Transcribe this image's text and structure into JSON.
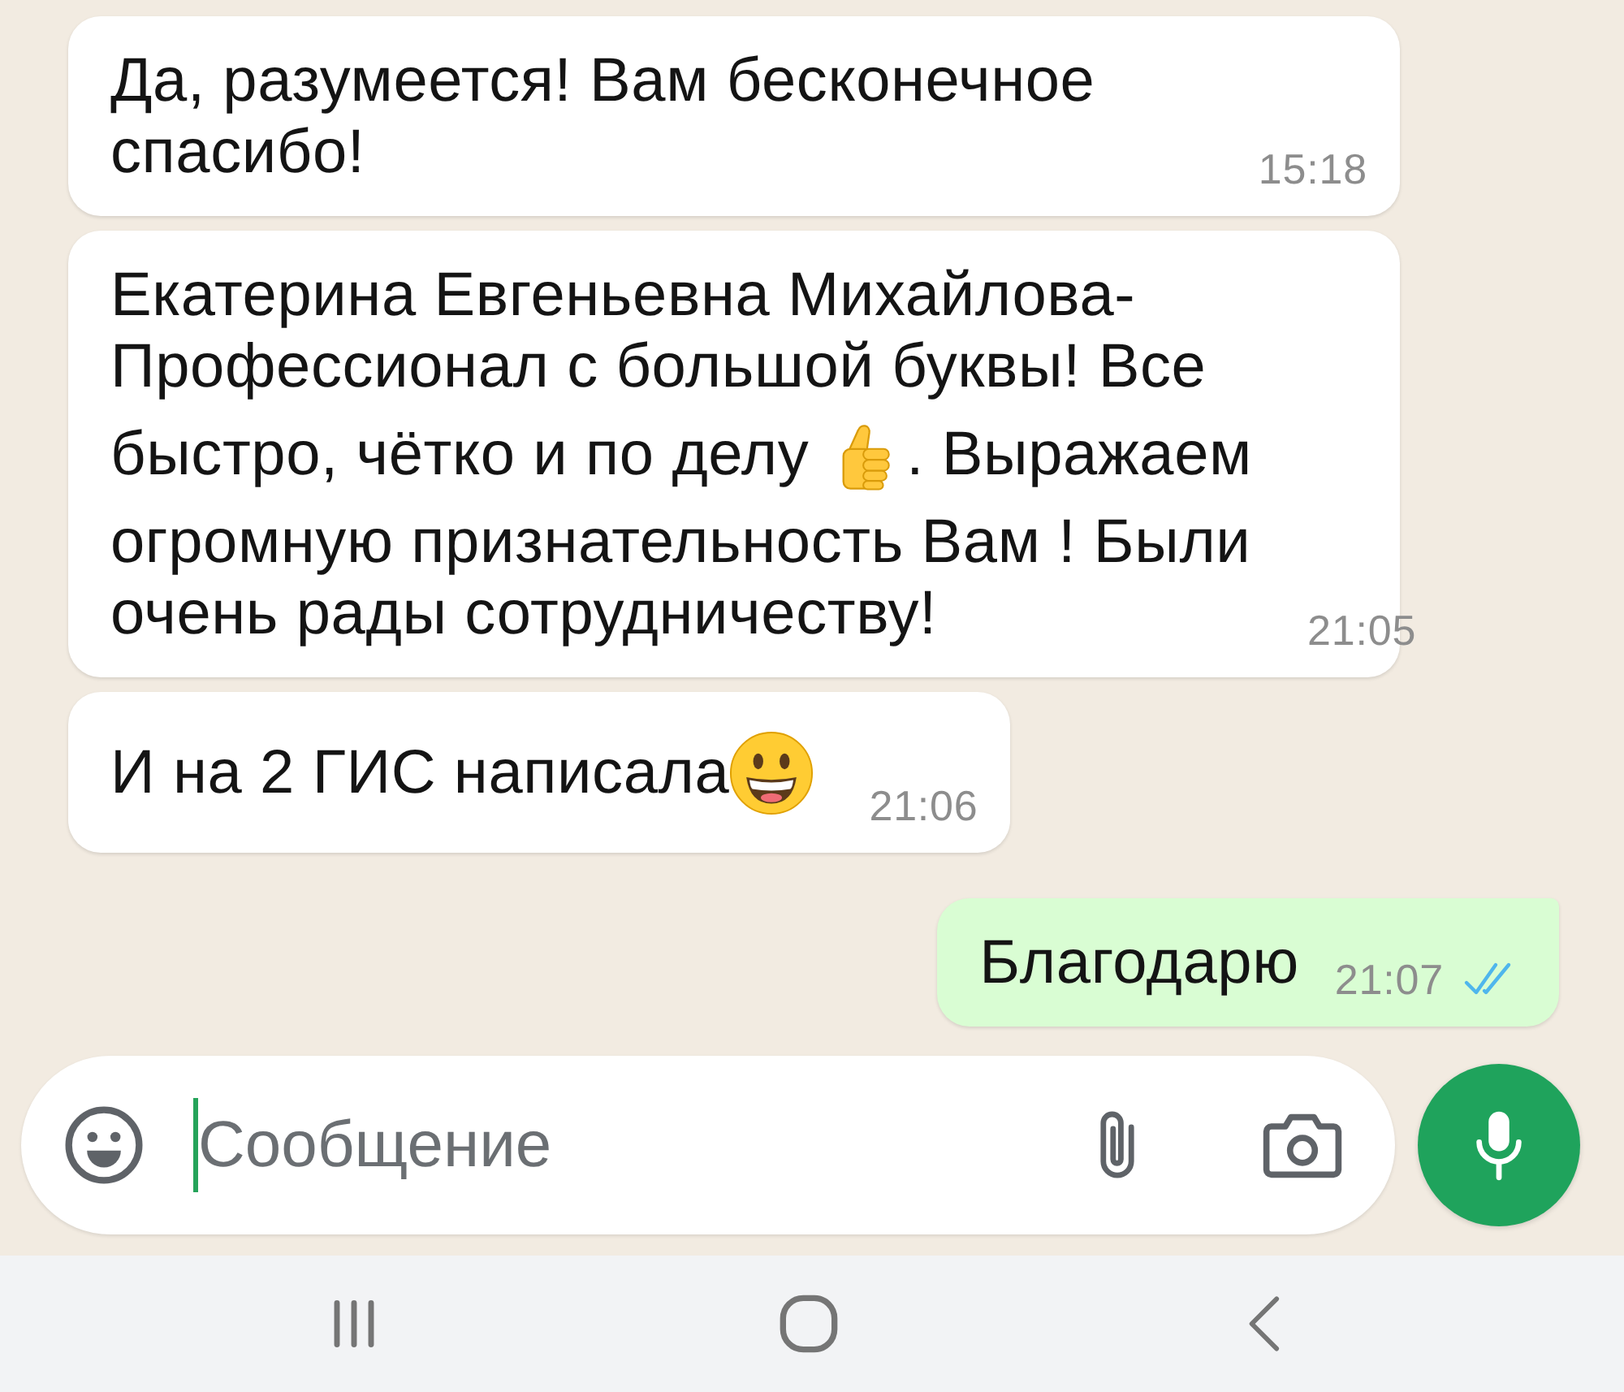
{
  "messages": [
    {
      "outgoing": false,
      "lines": [
        [
          {
            "kind": "text",
            "text": "Да, разумеется! Вам бесконечное"
          }
        ],
        [
          {
            "kind": "text",
            "text": "спасибо!"
          }
        ]
      ],
      "time": "15:18"
    },
    {
      "outgoing": false,
      "lines": [
        [
          {
            "kind": "text",
            "text": "Екатерина Евгеньевна Михайлова-"
          }
        ],
        [
          {
            "kind": "text",
            "text": "Профессионал с большой буквы! Все"
          }
        ],
        [
          {
            "kind": "text",
            "text": "быстро, чётко и по делу"
          },
          {
            "kind": "thumbsup"
          },
          {
            "kind": "text",
            "text": ". Выражаем"
          }
        ],
        [
          {
            "kind": "text",
            "text": "огромную признательность Вам ! Были"
          }
        ],
        [
          {
            "kind": "text",
            "text": "очень рады сотрудничеству!"
          }
        ]
      ],
      "time": "21:05"
    },
    {
      "outgoing": false,
      "lines": [
        [
          {
            "kind": "text",
            "text": "И на 2 ГИС написала"
          },
          {
            "kind": "grin"
          }
        ]
      ],
      "time": "21:06"
    },
    {
      "outgoing": true,
      "lines": [
        [
          {
            "kind": "text",
            "text": "Благодарю"
          }
        ]
      ],
      "time": "21:07",
      "read": true
    }
  ],
  "composer": {
    "placeholder": "Сообщение",
    "focused": true
  }
}
